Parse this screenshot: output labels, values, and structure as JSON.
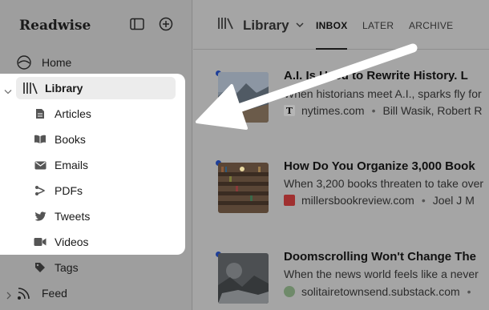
{
  "sidebar": {
    "brand": "Readwise",
    "home": "Home",
    "library": "Library",
    "sub_items": [
      {
        "label": "Articles",
        "icon": "article-icon"
      },
      {
        "label": "Books",
        "icon": "book-icon"
      },
      {
        "label": "Emails",
        "icon": "email-icon"
      },
      {
        "label": "PDFs",
        "icon": "pdf-icon"
      },
      {
        "label": "Tweets",
        "icon": "twitter-icon"
      },
      {
        "label": "Videos",
        "icon": "video-icon"
      }
    ],
    "tags": "Tags",
    "feed": "Feed"
  },
  "header": {
    "title": "Library",
    "tabs": [
      "INBOX",
      "LATER",
      "ARCHIVE"
    ],
    "active_tab": "INBOX"
  },
  "articles": [
    {
      "title": "A.I. Is Used to Rewrite History. L",
      "subtitle": "When historians meet A.I., sparks fly for",
      "source": "nytimes.com",
      "author": "Bill Wasik, Robert R"
    },
    {
      "title": "How Do You Organize 3,000 Book",
      "subtitle": "When 3,200 books threaten to take over",
      "source": "millersbookreview.com",
      "author": "Joel J M"
    },
    {
      "title": "Doomscrolling Won't Change The",
      "subtitle": "When the news world feels like a never",
      "source": "solitairetownsend.substack.com",
      "author": ""
    }
  ],
  "colors": {
    "unread_dot": "#1f3f99",
    "highlight_bg": "#ffffff",
    "arrow": "#ffffff"
  }
}
